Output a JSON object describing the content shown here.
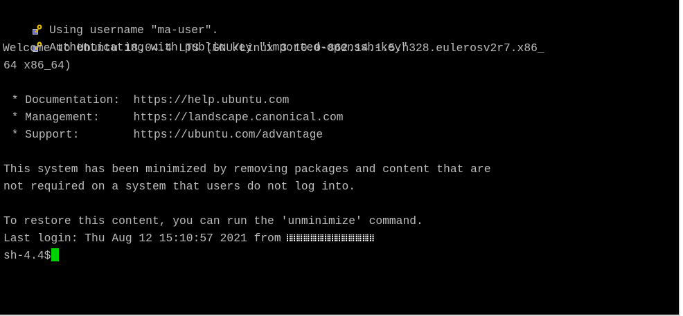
{
  "terminal": {
    "lines": [
      "Using username \"ma-user\".",
      "Authenticating with public key \"imported-openssh-key\"",
      "Welcome to Ubuntu 18.04.4 LTS (GNU/Linux 3.10.0-862.14.1.5.h328.eulerosv2r7.x86_",
      "64 x86_64)",
      " * Documentation:  https://help.ubuntu.com",
      " * Management:     https://landscape.canonical.com",
      " * Support:        https://ubuntu.com/advantage",
      "This system has been minimized by removing packages and content that are",
      "not required on a system that users do not log into.",
      "To restore this content, you can run the 'unminimize' command.",
      "Last login: Thu Aug 12 15:10:57 2021 from",
      "sh-4.4$"
    ],
    "key_icon": "key-icon",
    "cursor_color": "#00d200",
    "background": "#000000",
    "text_color": "#bbbbbb"
  }
}
